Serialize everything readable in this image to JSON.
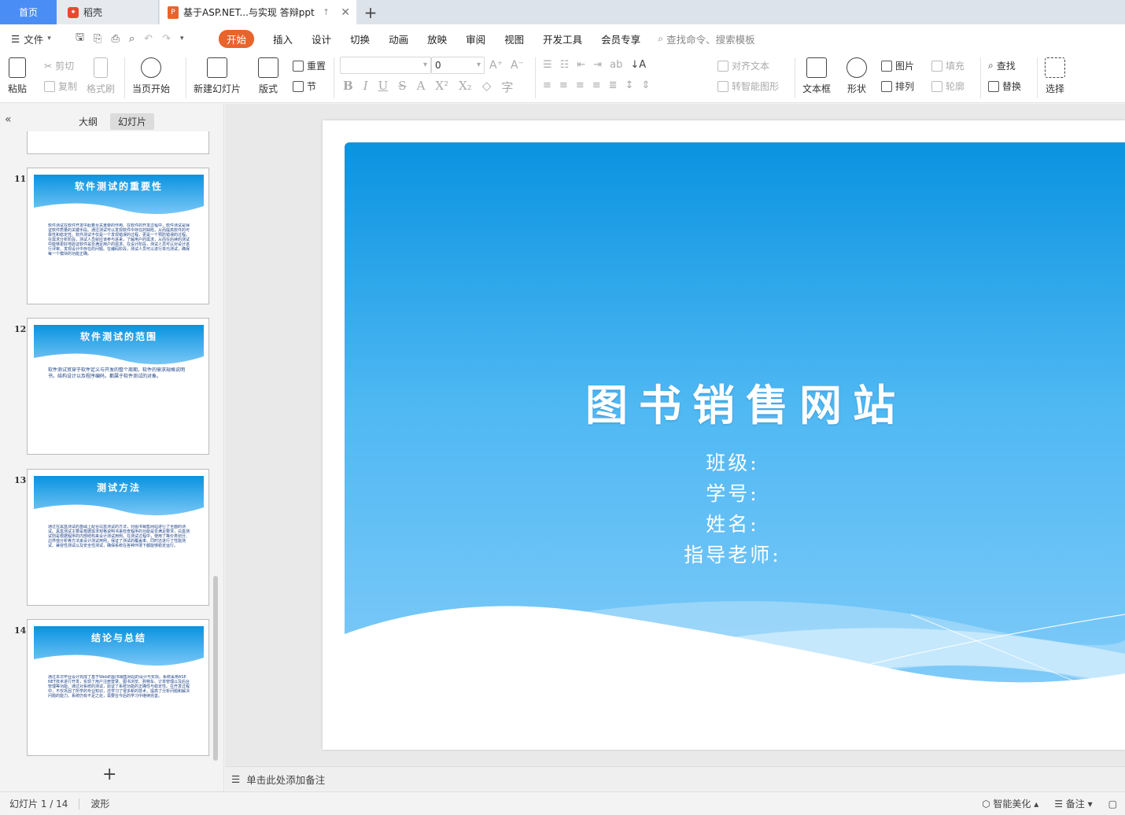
{
  "tabs": {
    "home": "首页",
    "docer": "稻壳",
    "document": "基于ASP.NET...与实现 答辩ppt",
    "new_tab": "+"
  },
  "menubar": {
    "file": "文件",
    "tabs": [
      "开始",
      "插入",
      "设计",
      "切换",
      "动画",
      "放映",
      "审阅",
      "视图",
      "开发工具",
      "会员专享"
    ],
    "active_tab": "开始",
    "search_placeholder": "查找命令、搜索模板"
  },
  "ribbon": {
    "paste": "粘贴",
    "cut": "剪切",
    "copy": "复制",
    "format_painter": "格式刷",
    "play_from_current": "当页开始",
    "new_slide": "新建幻灯片",
    "layout": "版式",
    "reset": "重置",
    "section": "节",
    "font_name": "",
    "font_size": "0",
    "align_text": "对齐文本",
    "to_smartart": "转智能图形",
    "textbox": "文本框",
    "shapes": "形状",
    "picture": "图片",
    "arrange": "排列",
    "fill": "填充",
    "outline": "轮廓",
    "find": "查找",
    "replace": "替换",
    "select": "选择"
  },
  "left_panel": {
    "tab_outline": "大纲",
    "tab_slides": "幻灯片",
    "active_tab": "幻灯片",
    "thumbnails": [
      {
        "num": "11",
        "title": "软件测试的重要性",
        "body": "软件测试在软件开发中起着至关重要的作用。在软件的开发过程中，软件测试是保证软件质量的关键手段。通过测试可以发现软件中存在的缺陷，从而提高软件的可靠性和稳定性。软件测试不仅是一个发现错误的过程，更是一个预防错误的过程。在需求分析阶段，测试人员就应该参与进来，了解用户的需求，从而在后续的测试中能够更好地验证软件是否满足用户的需求。在设计阶段，测试人员可以对设计进行评审，发现设计中存在的问题。在编码阶段，测试人员可以进行单元测试，确保每一个模块的功能正确。"
      },
      {
        "num": "12",
        "title": "软件测试的范围",
        "body": "软件测试贯穿于软件定义与开发的整个周期，软件的需求规格说明书，结构设计以及程序编码，都属于软件测试的对象。"
      },
      {
        "num": "13",
        "title": "测试方法",
        "body": "通过在黑盒测试的基础上配合白盒测试的方法，对图书销售网站进行了全面的测试。黑盒测试主要是根据需求规格说明书来检查程序的功能是否满足要求，白盒测试则是根据程序的内部结构来设计测试用例。在测试过程中，使用了等价类划分、边界值分析等方法来设计测试用例，保证了测试的覆盖率。同时还进行了性能测试、兼容性测试以及安全性测试，确保系统在各种环境下都能够稳定运行。"
      },
      {
        "num": "14",
        "title": "结论与总结",
        "body": "通过本次毕业设计完成了基于Web的图书销售网站的设计与实现。系统采用ASP.NET技术进行开发，实现了用户注册登录、图书浏览、购物车、订单管理以及后台管理等功能。通过对系统的测试，验证了系统功能的正确性与稳定性。在开发过程中，不仅巩固了所学的专业知识，还学习了很多新的技术，提高了分析问题和解决问题的能力。系统仍有不足之处，需要在今后的学习中继续完善。"
      }
    ],
    "add_slide": "+"
  },
  "slide": {
    "title": "图书销售网站",
    "info": [
      "班级:",
      "学号:",
      "姓名:",
      "指导老师:"
    ],
    "colors": {
      "top": "#0a93e0",
      "bottom": "#86cdf9",
      "wave": "#ffffff"
    }
  },
  "notes": {
    "placeholder": "单击此处添加备注"
  },
  "statusbar": {
    "slide_counter": "幻灯片 1 / 14",
    "theme": "波形",
    "smart_beautify": "智能美化",
    "notes": "备注"
  }
}
